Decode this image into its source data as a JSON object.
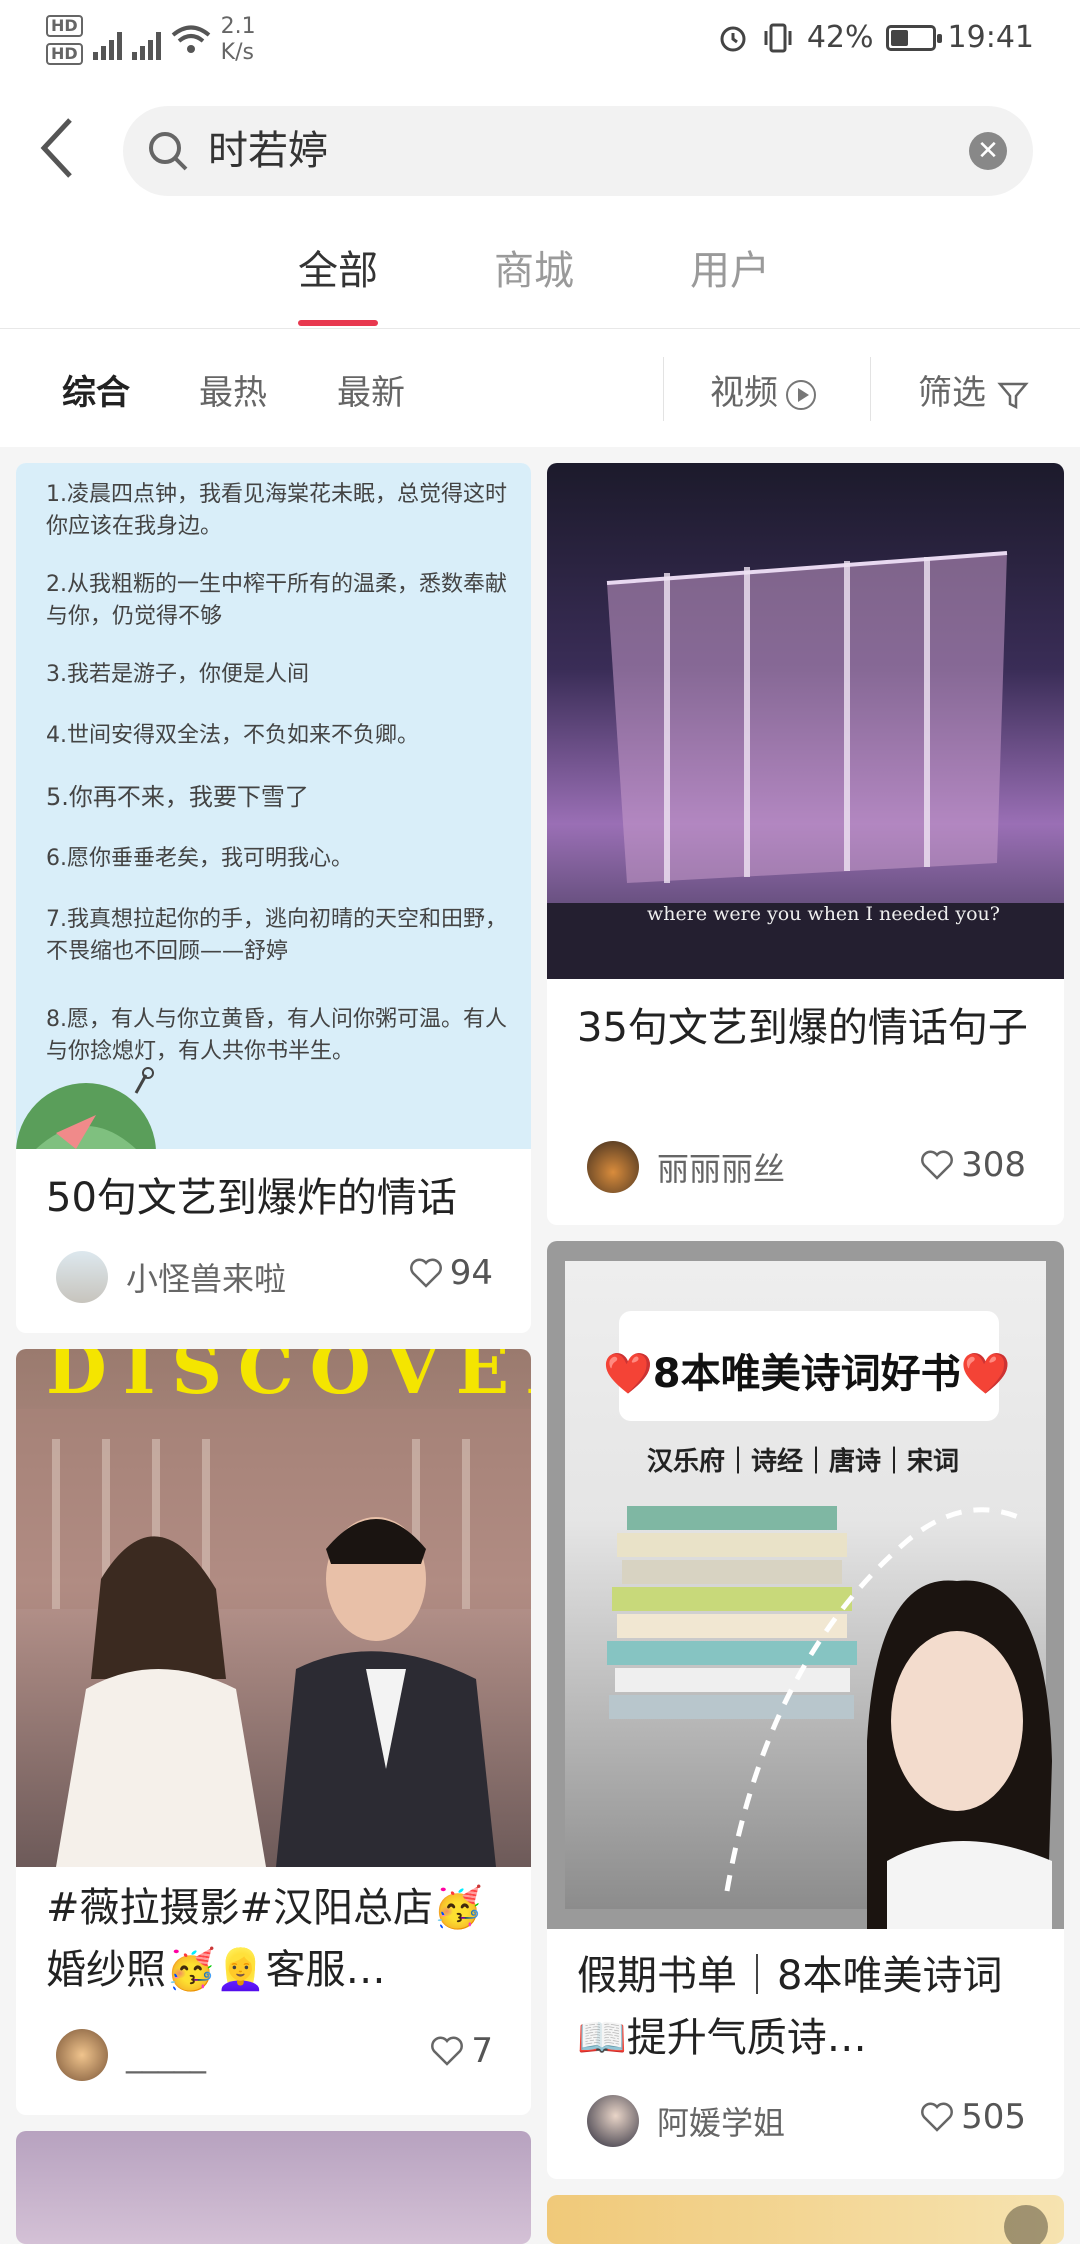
{
  "status": {
    "speed_value": "2.1",
    "speed_unit": "K/s",
    "battery": "42%",
    "time": "19:41"
  },
  "search": {
    "query": "时若婷"
  },
  "tabs": [
    "全部",
    "商城",
    "用户"
  ],
  "filters": {
    "sort": [
      "综合",
      "最热",
      "最新"
    ],
    "video": "视频",
    "filter": "筛选"
  },
  "cards": [
    {
      "title": "50句文艺到爆炸的情话",
      "author": "小怪兽来啦",
      "likes": "94",
      "quotes": [
        "1.凌晨四点钟，我看见海棠花未眠，总觉得这时你应该在我身边。",
        "2.从我粗粝的一生中榨干所有的温柔，悉数奉献与你，仍觉得不够",
        "3.我若是游子，你便是人间",
        "4.世间安得双全法，不负如来不负卿。",
        "5.你再不来，我要下雪了",
        "6.愿你垂垂老矣，我可明我心。",
        "7.我真想拉起你的手，逃向初晴的天空和田野，不畏缩也不回顾——舒婷",
        "8.愿，有人与你立黄昏，有人问你粥可温。有人与你捻熄灯，有人共你书半生。"
      ]
    },
    {
      "title": "35句文艺到爆的情话句子",
      "author": "丽丽丽丝",
      "likes": "308",
      "image_caption": "where were you when I needed you?"
    },
    {
      "title": "#薇拉摄影#汉阳总店🥳婚纱照🥳👱‍♀️客服…",
      "author": "_____",
      "likes": "7",
      "image_text": "DISCOVER"
    },
    {
      "title": "假期书单｜8本唯美诗词📖提升气质诗…",
      "author": "阿媛学姐",
      "likes": "505",
      "image_heading": "❤️8本唯美诗词好书❤️",
      "image_sub": "汉乐府｜诗经｜唐诗｜宋词"
    }
  ],
  "colors": {
    "accent": "#e8384f",
    "quote_bg": "#d9eef9"
  }
}
